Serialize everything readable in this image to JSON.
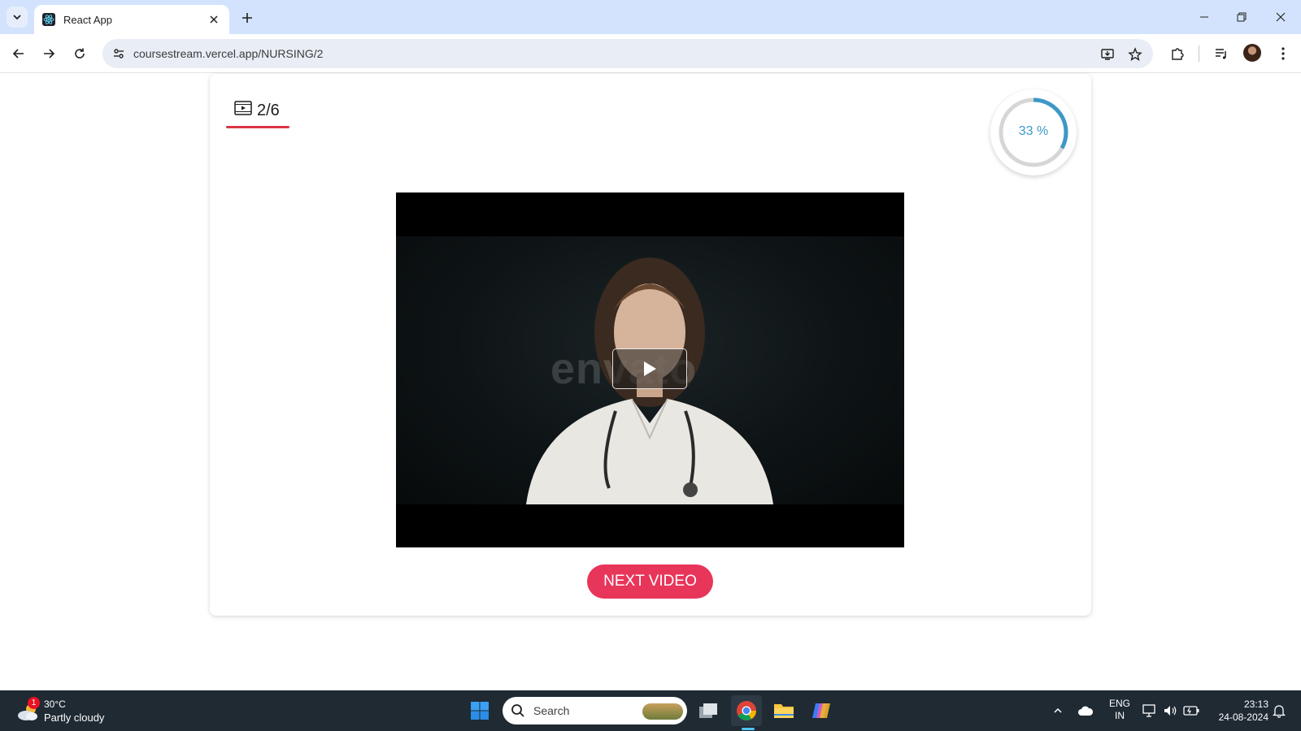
{
  "browser": {
    "tab": {
      "title": "React App"
    },
    "url": "coursestream.vercel.app/NURSING/2"
  },
  "page": {
    "video_counter": "2/6",
    "progress": {
      "label": "33 %",
      "value_percent": 33
    },
    "video": {
      "watermark": "envato"
    },
    "next_button_label": "NEXT VIDEO",
    "colors": {
      "accent": "#e8355a",
      "progress": "#3e98c7",
      "progress_track": "#d6d6d6",
      "underline": "#dc3545"
    }
  },
  "taskbar": {
    "weather": {
      "temp": "30°C",
      "condition": "Partly cloudy",
      "badge": "1"
    },
    "search_placeholder": "Search",
    "tray": {
      "lang_line1": "ENG",
      "lang_line2": "IN",
      "time": "23:13",
      "date": "24-08-2024"
    }
  }
}
